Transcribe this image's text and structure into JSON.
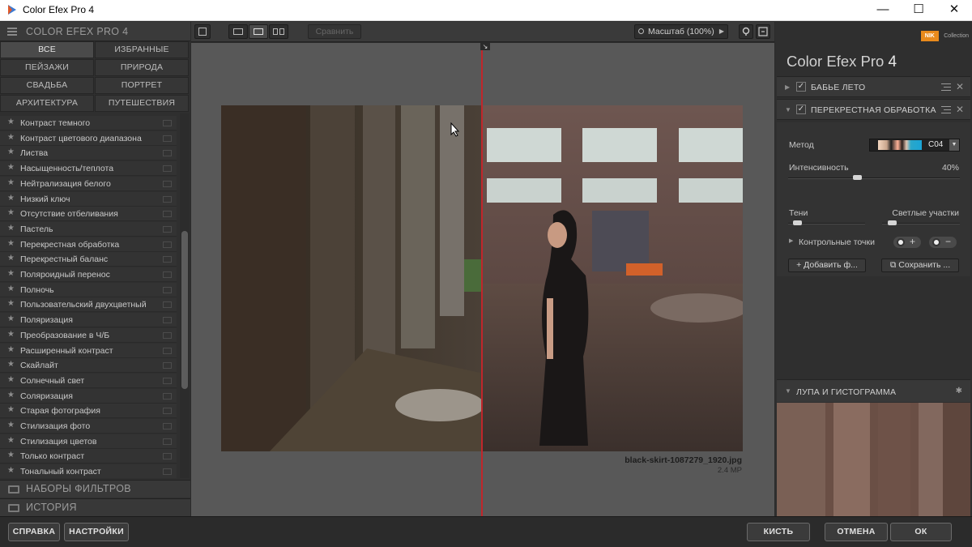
{
  "window": {
    "title": "Color Efex Pro 4",
    "minimize": "—",
    "maximize": "☐",
    "close": "✕"
  },
  "left": {
    "header": "COLOR EFEX PRO 4",
    "categories": [
      "ВСЕ",
      "ИЗБРАННЫЕ",
      "ПЕЙЗАЖИ",
      "ПРИРОДА",
      "СВАДЬБА",
      "ПОРТРЕТ",
      "АРХИТЕКТУРА",
      "ПУТЕШЕСТВИЯ"
    ],
    "filters": [
      "Контраст темного",
      "Контраст цветового диапазона",
      "Листва",
      "Насыщенность/теплота",
      "Нейтрализация белого",
      "Низкий ключ",
      "Отсутствие отбеливания",
      "Пастель",
      "Перекрестная обработка",
      "Перекрестный баланс",
      "Поляроидный перенос",
      "Полночь",
      "Пользовательский двухцветный",
      "Поляризация",
      "Преобразование в Ч/Б",
      "Расширенный контраст",
      "Скайлайт",
      "Солнечный свет",
      "Соляризация",
      "Старая фотография",
      "Стилизация фото",
      "Стилизация цветов",
      "Только контраст",
      "Тональный контраст"
    ],
    "presets": "НАБОРЫ ФИЛЬТРОВ",
    "history": "ИСТОРИЯ"
  },
  "toolbar": {
    "compare": "Сравнить",
    "zoom": "Масштаб (100%)"
  },
  "preview": {
    "filename": "black-skirt-1087279_1920.jpg",
    "size": "2.4 MP"
  },
  "right": {
    "nik_badge": "NIK",
    "nik_collection": "Collection",
    "brand": "Color Efex Pro",
    "brand_version": "4",
    "filter1": "БАБЬЕ ЛЕТО",
    "filter2": "ПЕРЕКРЕСТНАЯ ОБРАБОТКА",
    "method_label": "Метод",
    "method_value": "C04",
    "intensity_label": "Интенсивность",
    "intensity_value": "40%",
    "intensity_level": 0.4,
    "shadows_label": "Тени",
    "shadows_level": 0.12,
    "highlights_label": "Светлые участки",
    "highlights_level": 0.12,
    "control_points": "Контрольные точки",
    "add_button": "Добавить ф...",
    "save_button": "Сохранить ...",
    "loupe": "ЛУПА И ГИСТОГРАММА"
  },
  "bottom": {
    "help": "СПРАВКА",
    "settings": "НАСТРОЙКИ",
    "brush": "КИСТЬ",
    "cancel": "ОТМЕНА",
    "ok": "ОК"
  }
}
